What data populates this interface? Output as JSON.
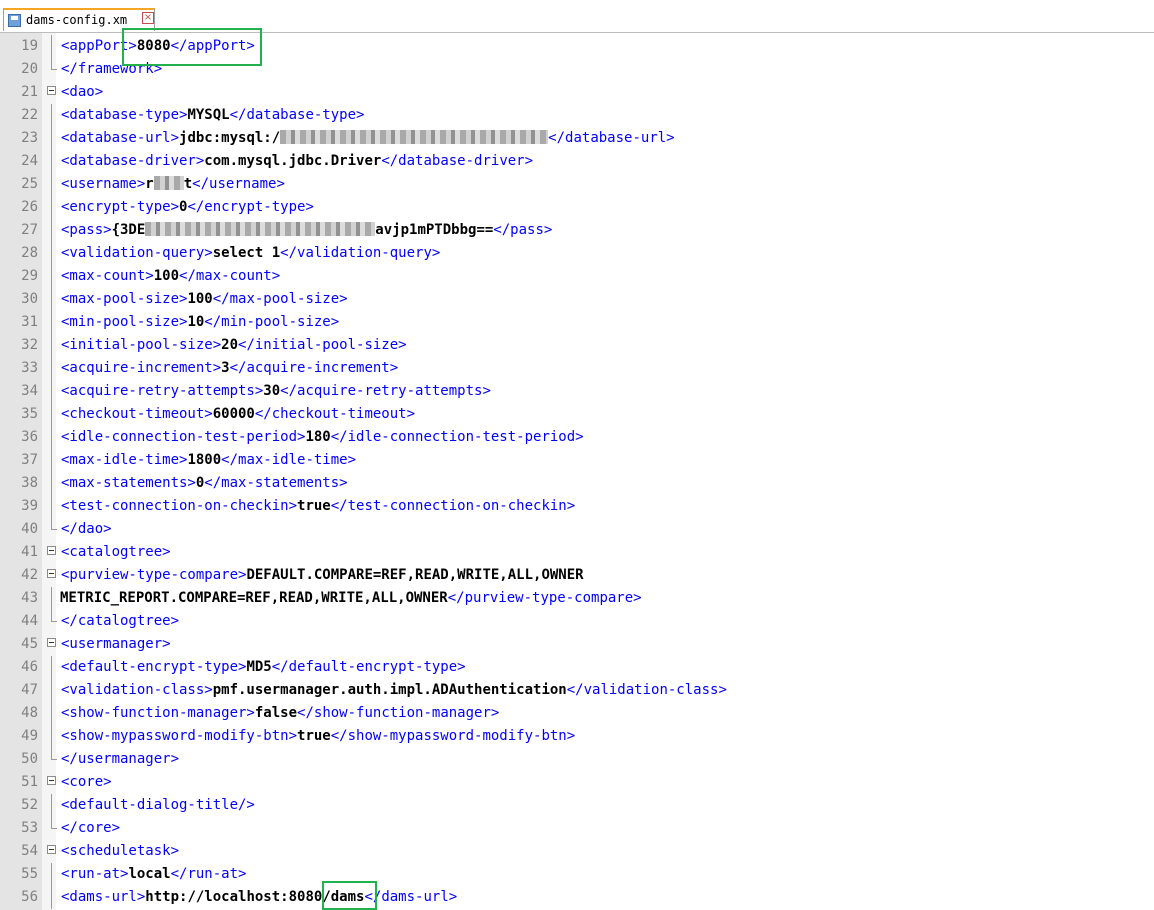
{
  "tab": {
    "label": "dams-config.xm",
    "close_glyph": "×",
    "icon": "floppy-disk-icon",
    "close_icon": "close-icon"
  },
  "accents": {
    "tag_color": "#0000ff",
    "highlight_color": "#22b14c"
  },
  "lines": [
    {
      "num": "19",
      "open": "<appPort>",
      "value": "8080",
      "close": "</appPort>"
    },
    {
      "num": "20",
      "text": "</framework>"
    },
    {
      "num": "21",
      "text": "<dao>"
    },
    {
      "num": "22",
      "open": "<database-type>",
      "value": "MYSQL",
      "close": "</database-type>"
    },
    {
      "num": "23",
      "open": "<database-url>",
      "value": "jdbc:mysql:/",
      "close": "</database-url>"
    },
    {
      "num": "24",
      "open": "<database-driver>",
      "value": "com.mysql.jdbc.Driver",
      "close": "</database-driver>"
    },
    {
      "num": "25",
      "open": "<username>",
      "value": "r",
      "value_tail": "t",
      "close": "</username>"
    },
    {
      "num": "26",
      "open": "<encrypt-type>",
      "value": "0",
      "close": "</encrypt-type>"
    },
    {
      "num": "27",
      "open": "<pass>",
      "value": "{3DE",
      "value_tail": "avjp1mPTDbbg==",
      "close": "</pass>"
    },
    {
      "num": "28",
      "open": "<validation-query>",
      "value": "select 1",
      "close": "</validation-query>"
    },
    {
      "num": "29",
      "open": "<max-count>",
      "value": "100",
      "close": "</max-count>"
    },
    {
      "num": "30",
      "open": "<max-pool-size>",
      "value": "100",
      "close": "</max-pool-size>"
    },
    {
      "num": "31",
      "open": "<min-pool-size>",
      "value": "10",
      "close": "</min-pool-size>"
    },
    {
      "num": "32",
      "open": "<initial-pool-size>",
      "value": "20",
      "close": "</initial-pool-size>"
    },
    {
      "num": "33",
      "open": "<acquire-increment>",
      "value": "3",
      "close": "</acquire-increment>"
    },
    {
      "num": "34",
      "open": "<acquire-retry-attempts>",
      "value": "30",
      "close": "</acquire-retry-attempts>"
    },
    {
      "num": "35",
      "open": "<checkout-timeout>",
      "value": "60000",
      "close": "</checkout-timeout>"
    },
    {
      "num": "36",
      "open": "<idle-connection-test-period>",
      "value": "180",
      "close": "</idle-connection-test-period>"
    },
    {
      "num": "37",
      "open": "<max-idle-time>",
      "value": "1800",
      "close": "</max-idle-time>"
    },
    {
      "num": "38",
      "open": "<max-statements>",
      "value": "0",
      "close": "</max-statements>"
    },
    {
      "num": "39",
      "open": "<test-connection-on-checkin>",
      "value": "true",
      "close": "</test-connection-on-checkin>"
    },
    {
      "num": "40",
      "text": "</dao>"
    },
    {
      "num": "41",
      "text": "<catalogtree>"
    },
    {
      "num": "42",
      "open": "<purview-type-compare>",
      "value": "DEFAULT.COMPARE=REF,READ,WRITE,ALL,OWNER"
    },
    {
      "num": "43",
      "value": "METRIC_REPORT.COMPARE=REF,READ,WRITE,ALL,OWNER",
      "close": "</purview-type-compare>"
    },
    {
      "num": "44",
      "text": "</catalogtree>"
    },
    {
      "num": "45",
      "text": "<usermanager>"
    },
    {
      "num": "46",
      "open": "<default-encrypt-type>",
      "value": "MD5",
      "close": "</default-encrypt-type>"
    },
    {
      "num": "47",
      "open": "<validation-class>",
      "value": "pmf.usermanager.auth.impl.ADAuthentication",
      "close": "</validation-class>"
    },
    {
      "num": "48",
      "open": "<show-function-manager>",
      "value": "false",
      "close": "</show-function-manager>"
    },
    {
      "num": "49",
      "open": "<show-mypassword-modify-btn>",
      "value": "true",
      "close": "</show-mypassword-modify-btn>"
    },
    {
      "num": "50",
      "text": "</usermanager>"
    },
    {
      "num": "51",
      "text": "<core>"
    },
    {
      "num": "52",
      "text": "<default-dialog-title/>"
    },
    {
      "num": "53",
      "text": "</core>"
    },
    {
      "num": "54",
      "text": "<scheduletask>"
    },
    {
      "num": "55",
      "open": "<run-at>",
      "value": "local",
      "close": "</run-at>"
    },
    {
      "num": "56",
      "open": "<dams-url>",
      "value": "http://localhost:",
      "value_mid": "8080",
      "value_tail": "/dams",
      "close": "</dams-url>"
    }
  ]
}
